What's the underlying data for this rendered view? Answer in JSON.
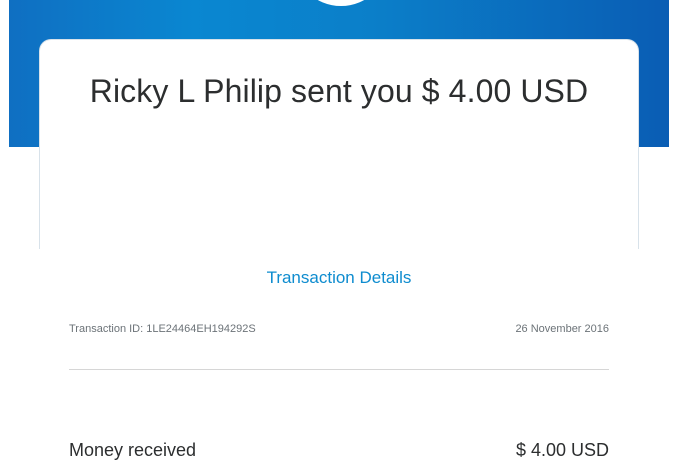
{
  "header": {
    "brand_color": "#0a7fc9"
  },
  "card": {
    "headline": "Ricky L Philip sent you $ 4.00 USD"
  },
  "transaction": {
    "details_link": "Transaction Details",
    "id_text": "Transaction ID: 1LE24464EH194292S",
    "date": "26 November 2016"
  },
  "summary": {
    "label": "Money received",
    "amount": "$ 4.00 USD"
  }
}
